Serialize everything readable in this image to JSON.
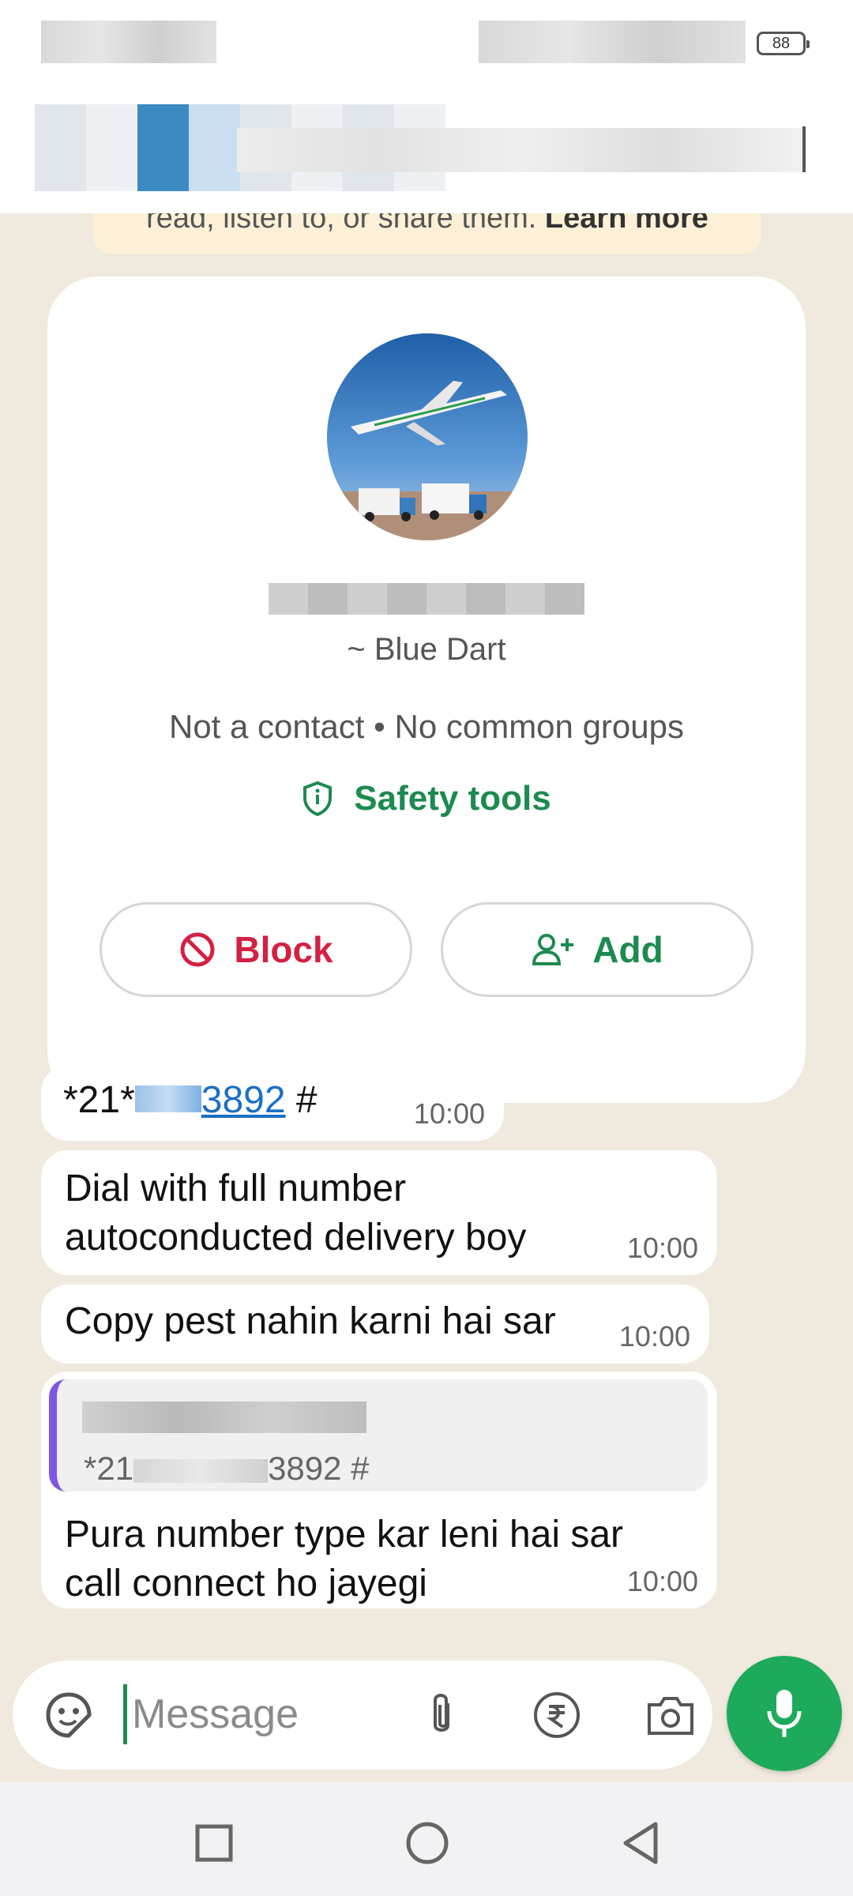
{
  "status_bar": {
    "battery": "88"
  },
  "notice": {
    "text": "read, listen to, or share them.",
    "link": "Learn more"
  },
  "profile": {
    "push_name": "~ Blue Dart",
    "info": "Not a contact • No common groups",
    "safety_label": "Safety tools",
    "block_label": "Block",
    "add_label": "Add"
  },
  "messages": [
    {
      "prefix": "*21*",
      "link_suffix": "3892",
      "suffix": " #",
      "time": "10:00"
    },
    {
      "text": "Dial with full number autoconducted delivery boy",
      "time": "10:00"
    },
    {
      "text": "Copy pest nahin karni hai sar",
      "time": "10:00"
    },
    {
      "quote_prefix": "*21",
      "quote_suffix": "3892 #",
      "text": "Pura number type kar leni hai sar call connect ho jayegi",
      "time": "10:00"
    }
  ],
  "composer": {
    "placeholder": "Message"
  },
  "colors": {
    "accent": "#1d8a50",
    "block": "#d42042",
    "link": "#1b6fc6",
    "mic": "#1daa5a"
  }
}
